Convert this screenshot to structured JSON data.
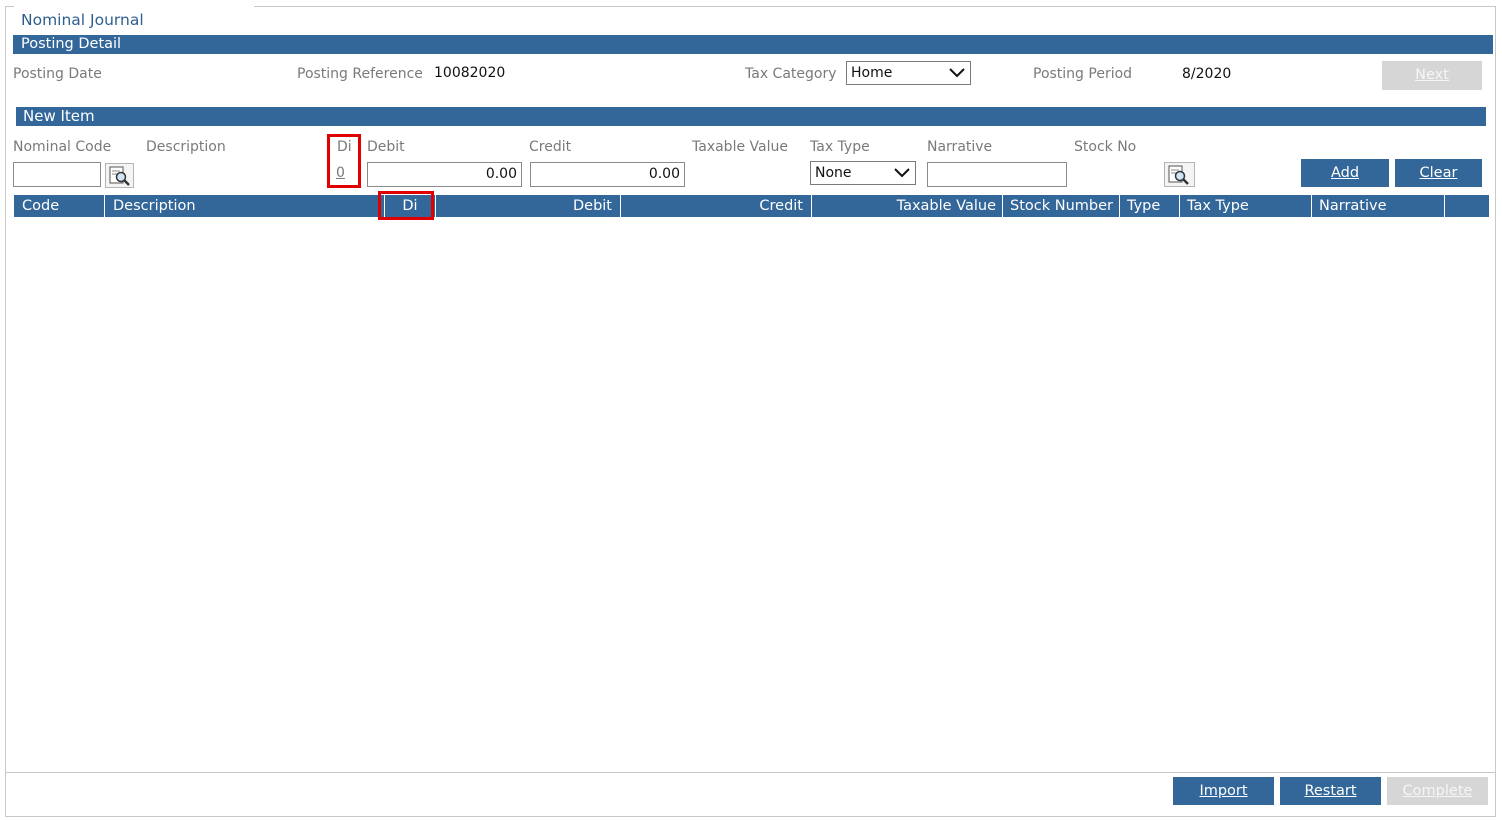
{
  "window": {
    "title": "Nominal Journal"
  },
  "posting_detail": {
    "header": "Posting Detail",
    "posting_date_label": "Posting Date",
    "posting_reference_label": "Posting Reference",
    "posting_reference_value": "10082020",
    "tax_category_label": "Tax Category",
    "tax_category_value": "Home",
    "posting_period_label": "Posting Period",
    "posting_period_value": "8/2020",
    "next_label": "Next"
  },
  "new_item": {
    "header": "New Item",
    "nominal_code_label": "Nominal Code",
    "nominal_code_value": "",
    "description_label": "Description",
    "di_label": "Di",
    "di_value": "0",
    "debit_label": "Debit",
    "debit_value": "0.00",
    "credit_label": "Credit",
    "credit_value": "0.00",
    "taxable_value_label": "Taxable Value",
    "tax_type_label": "Tax Type",
    "tax_type_value": "None",
    "narrative_label": "Narrative",
    "narrative_value": "",
    "stock_no_label": "Stock No",
    "add_label": "Add",
    "clear_label": "Clear"
  },
  "grid": {
    "columns": [
      "Code",
      "Description",
      "Di",
      "Debit",
      "Credit",
      "Taxable Value",
      "Stock Number",
      "Type",
      "Tax Type",
      "Narrative"
    ]
  },
  "footer": {
    "import_label": "Import",
    "restart_label": "Restart",
    "complete_label": "Complete"
  },
  "colors": {
    "header_bar": "#336699",
    "highlight": "#e00000",
    "disabled_button": "#d6d6d6"
  }
}
